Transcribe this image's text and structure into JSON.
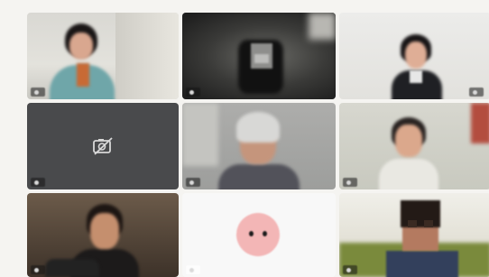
{
  "meeting": {
    "participants": [
      {
        "id": 1,
        "name": "",
        "camera": "on"
      },
      {
        "id": 2,
        "name": "",
        "camera": "on"
      },
      {
        "id": 3,
        "name": "",
        "camera": "on"
      },
      {
        "id": 4,
        "name": "",
        "camera": "off",
        "icon": "camera-off-icon"
      },
      {
        "id": 5,
        "name": "",
        "camera": "on"
      },
      {
        "id": 6,
        "name": "",
        "camera": "on"
      },
      {
        "id": 7,
        "name": "",
        "camera": "on"
      },
      {
        "id": 8,
        "name": "",
        "camera": "off",
        "icon": "avatar-icon"
      },
      {
        "id": 9,
        "name": "",
        "camera": "on"
      }
    ]
  },
  "colors": {
    "page_background": "#f5f4f1",
    "camera_off_tile": "#494a4c",
    "avatar_background": "#f3b6b6"
  }
}
